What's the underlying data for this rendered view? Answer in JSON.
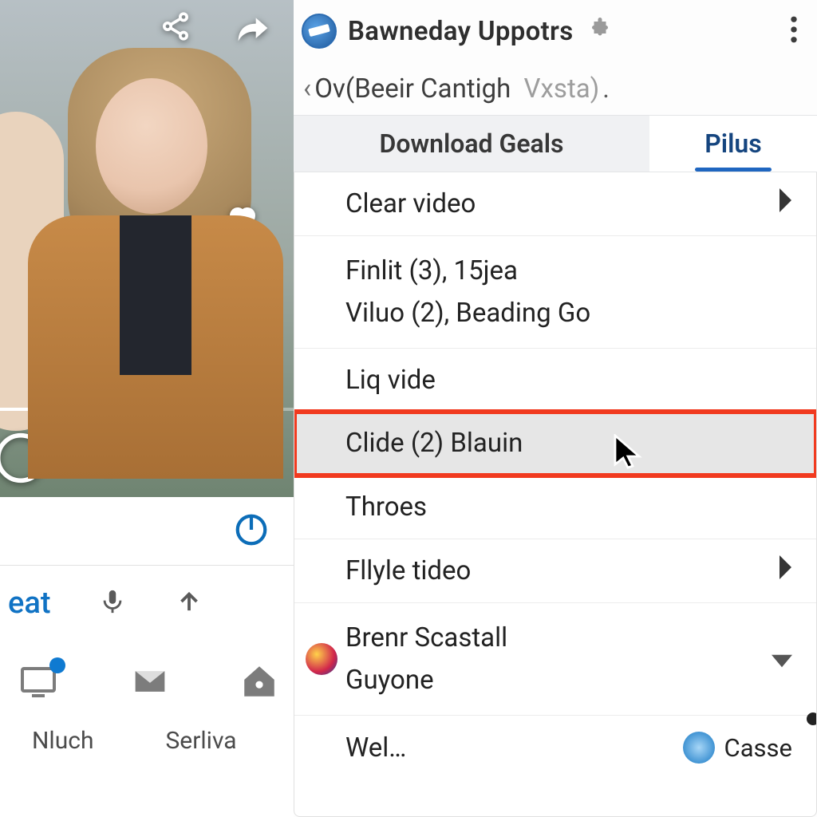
{
  "left": {
    "input_hint": "eat",
    "nav_labels": [
      "Nluch",
      "Serliva"
    ]
  },
  "right": {
    "header_title": "Bawneday Uppotrs",
    "breadcrumb": {
      "back_label": "Ov(Beeir Cantigh",
      "secondary": "Vxsta)",
      "trailing": "."
    },
    "tabs": {
      "a": "Download Geals",
      "b": "Pilus"
    },
    "menu": {
      "item1": "Clear video",
      "item2a": "Finlit (3), 15jea",
      "item2b": "Viluo (2), Beading Go",
      "item3": "Liq vide",
      "item4": "Clide (2) Blauin",
      "item5": "Throes",
      "item6": "Fllyle tideo",
      "item7a": "Brenr Scastall",
      "item7b": "Guyone",
      "item8": "Wel…",
      "item8_right": "Casse"
    }
  }
}
